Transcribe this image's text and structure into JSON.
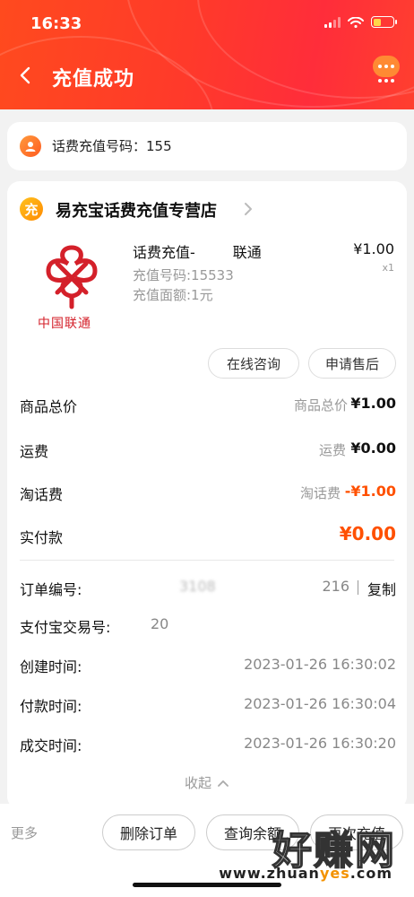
{
  "status_bar": {
    "time": "16:33"
  },
  "header": {
    "title": "充值成功"
  },
  "phone_card": {
    "label": "话费充值号码：155"
  },
  "shop": {
    "logo_char": "充",
    "name": "易充宝话费充值专营店"
  },
  "product": {
    "brand_text": "中国联通",
    "title": "话费充值-",
    "title_suffix": "联通",
    "price": "¥1.00",
    "qty": "x1",
    "attr_number": "充值号码:15533",
    "attr_amount": "充值面额:1元"
  },
  "actions": {
    "consult": "在线咨询",
    "after_sale": "申请售后"
  },
  "summary": {
    "goods_total": {
      "label": "商品总价",
      "sub": "商品总价",
      "value": "¥1.00"
    },
    "shipping": {
      "label": "运费",
      "sub": "运费",
      "value": "¥0.00"
    },
    "taobao_fee": {
      "label": "淘话费",
      "sub": "淘话费",
      "value": "-¥1.00"
    },
    "paid": {
      "label": "实付款",
      "value": "¥0.00"
    }
  },
  "details": {
    "order_no": {
      "label": "订单编号:",
      "value_tail": "216",
      "copy": "复制"
    },
    "alipay_no": {
      "label": "支付宝交易号:",
      "value_head": "20"
    },
    "created": {
      "label": "创建时间:",
      "value": "2023-01-26 16:30:02"
    },
    "paid_time": {
      "label": "付款时间:",
      "value": "2023-01-26 16:30:04"
    },
    "deal_time": {
      "label": "成交时间:",
      "value": "2023-01-26 16:30:20"
    },
    "collapse": "收起"
  },
  "bottom_bar": {
    "more": "更多",
    "delete": "删除订单",
    "balance": "查询余额",
    "again": "再次充值"
  },
  "watermark": {
    "big": "好赚网",
    "small_a": "www.zhuan",
    "small_b": "yes",
    "small_c": ".com"
  },
  "colors": {
    "accent": "#ff5000",
    "header": "#ff3a2a",
    "unicom_red": "#d4202a"
  }
}
